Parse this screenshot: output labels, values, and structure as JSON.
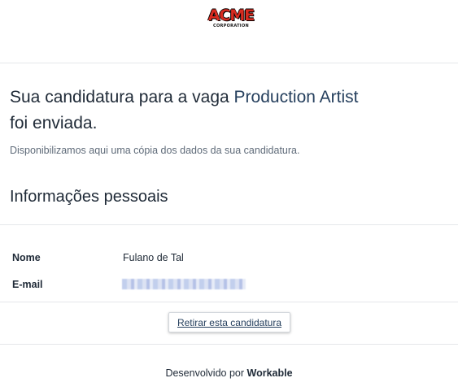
{
  "logo": {
    "main_text": "ACME",
    "sub_text": "CORPORATION"
  },
  "confirmation": {
    "title_prefix": "Sua candidatura para a vaga",
    "job_title": "Production Artist",
    "title_suffix": "foi enviada.",
    "subtitle": "Disponibilizamos aqui uma cópia dos dados da sua candidatura."
  },
  "personal_info": {
    "heading": "Informações pessoais",
    "fields": [
      {
        "label": "Nome",
        "value": "Fulano de Tal"
      },
      {
        "label": "E-mail",
        "value": ""
      }
    ]
  },
  "actions": {
    "withdraw_label": "Retirar esta candidatura"
  },
  "footer": {
    "prefix": "Desenvolvido por",
    "brand": "Workable"
  },
  "colors": {
    "accent": "#26405e",
    "logo_red": "#d82b20",
    "muted": "#5f6b79"
  }
}
